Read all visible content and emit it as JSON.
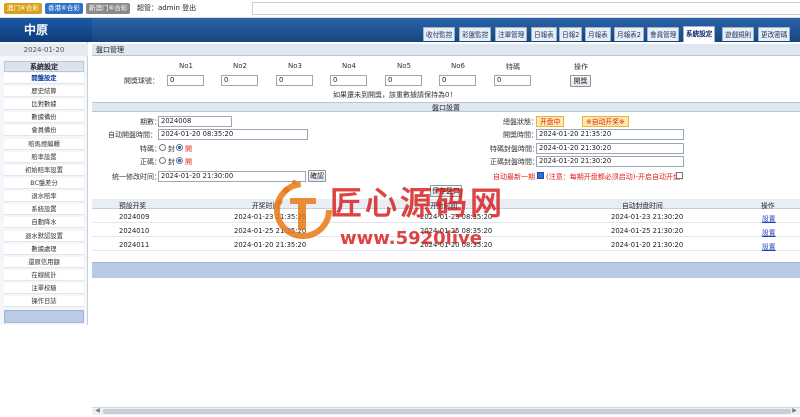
{
  "top": {
    "lottery_buttons": [
      {
        "label": "澳门⑥合彩",
        "color": "#d9a21a"
      },
      {
        "label": "香港⑥合彩",
        "color": "#2d72c7"
      },
      {
        "label": "新澳门⑥合彩",
        "color": "#8a8a8a"
      }
    ],
    "user_info": "超管：admin  登出"
  },
  "header": {
    "logo": "中原",
    "tabs": [
      "收付監控",
      "彩盤監控",
      "注單管理",
      "日報表",
      "日報2",
      "月報表",
      "月報表2",
      "會員管理",
      "系統設定",
      "遊戲規則",
      "更改密碼"
    ],
    "active_tab": "系統設定"
  },
  "sidebar": {
    "date": "2024-01-20",
    "section": "系統設定",
    "items": [
      "開盤設定",
      "歷史結算",
      "比對數據",
      "數據備份",
      "會員備份",
      "賠馬燈編輯",
      "賠率設置",
      "初始賠率設置",
      "BC盤差分",
      "退水賠率",
      "系統設置",
      "自動降水",
      "退水默認設置",
      "數據處理",
      "還原信用額",
      "在線統計",
      "注單校驗",
      "操作日誌"
    ],
    "active_item": "開盤設定"
  },
  "panel": {
    "title": "盤口管理",
    "columns": [
      "No1",
      "No2",
      "No3",
      "No4",
      "No5",
      "No6",
      "特碼",
      "操作"
    ],
    "row_label": "開獎球號：",
    "ball_values": [
      "0",
      "0",
      "0",
      "0",
      "0",
      "0",
      "0"
    ],
    "open_button": "開獎",
    "note": "如果還未到開獎，該重數據請保持為0！"
  },
  "settings": {
    "title": "盤口設置",
    "period_label": "期數：",
    "period_value": "2024008",
    "auto_open_label": "自动開盤時間：",
    "auto_open_value": "2024-01-20 08:35:20",
    "tema_label": "特碼：",
    "zhengma_label": "正碼：",
    "option_open": "封",
    "option_closed": "開",
    "unify_label": "统一修改时间：",
    "unify_value": "2024-01-20 21:30:00",
    "unify_button": "確認",
    "status_label": "總盤狀態：",
    "status_value": "开盘中",
    "auto_toggle": "※自动开奖※",
    "open_time_label": "開獎時間：",
    "open_time_value": "2024-01-20 21:35:20",
    "tema_close_label": "特碼封盤時間：",
    "tema_close_value": "2024-01-20 21:30:20",
    "zhengma_close_label": "正碼封盤時間：",
    "zhengma_close_value": "2024-01-20 21:30:20",
    "auto_refresh_label": "自动最新一期",
    "warning": "(注意：每期开盘都必须启动)-开启自动开盘：",
    "save_button": "保存盤口"
  },
  "table": {
    "headers": [
      "預設开奖",
      "开奖时间",
      "开盘时间",
      "自动封盘时间",
      "操作"
    ],
    "rows": [
      {
        "period": "2024009",
        "open_time": "2024-01-23 21:35:20",
        "start_time": "2024-01-23 08:35:20",
        "close_time": "2024-01-23 21:30:20",
        "action": "設置"
      },
      {
        "period": "2024010",
        "open_time": "2024-01-25 21:35:20",
        "start_time": "2024-01-25 08:35:20",
        "close_time": "2024-01-25 21:30:20",
        "action": "設置"
      },
      {
        "period": "2024011",
        "open_time": "2024-01-20 21:35:20",
        "start_time": "2024-01-20 08:35:20",
        "close_time": "2024-01-20 21:30:20",
        "action": "設置"
      }
    ]
  },
  "watermark": {
    "text": "匠心源码网",
    "url": "www.5920live"
  }
}
